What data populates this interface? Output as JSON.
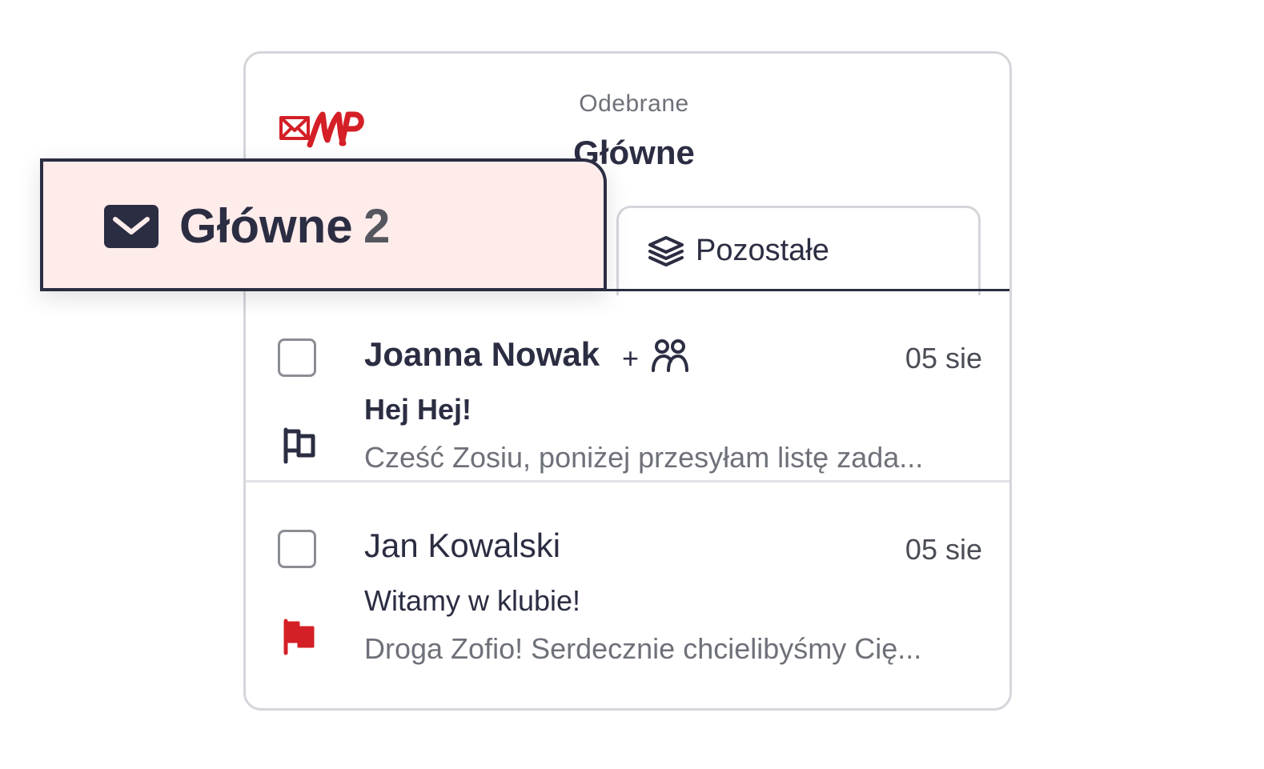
{
  "header": {
    "folder_label": "Odebrane",
    "folder_title": "Główne"
  },
  "tabs": {
    "main": {
      "label": "Główne",
      "count": "2",
      "icon": "envelope-icon"
    },
    "other": {
      "label": "Pozostałe",
      "icon": "layers-icon"
    }
  },
  "colors": {
    "accent_red": "#d41f26",
    "text_dark": "#2b2d42",
    "badge_bg": "#feeceb",
    "muted_text": "#6e7179"
  },
  "mails": [
    {
      "sender": "Joanna Nowak",
      "extra": "+",
      "extra_icon": "group-icon",
      "date": "05 sie",
      "subject": "Hej Hej!",
      "preview": "Cześć Zosiu, poniżej przesyłam listę zada...",
      "unread": true,
      "flagged": false
    },
    {
      "sender": "Jan Kowalski",
      "date": "05 sie",
      "subject": "Witamy w klubie!",
      "preview": "Droga Zofio! Serdecznie chcielibyśmy Cię...",
      "unread": false,
      "flagged": true
    }
  ]
}
